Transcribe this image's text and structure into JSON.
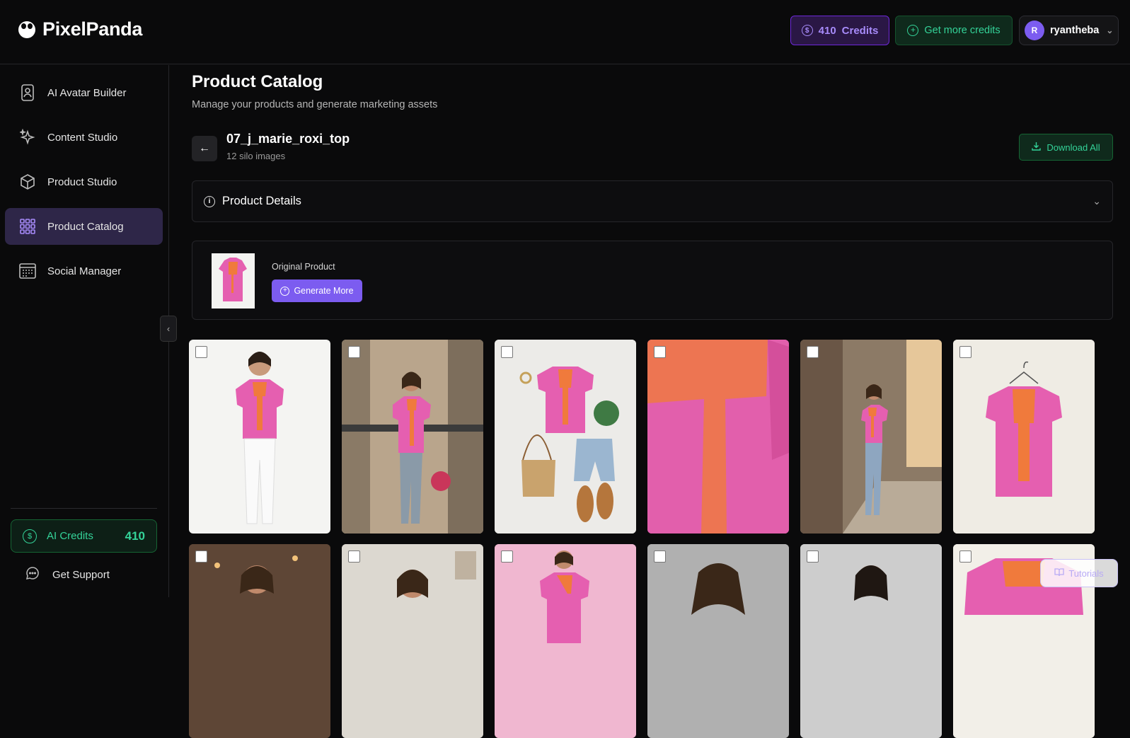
{
  "app": {
    "name": "PixelPanda"
  },
  "header": {
    "credits_count": "410",
    "credits_label": "Credits",
    "get_more_label": "Get more credits",
    "user_initial": "R",
    "username": "ryantheba"
  },
  "sidebar": {
    "items": [
      {
        "label": "AI Avatar Builder",
        "icon": "avatar-icon"
      },
      {
        "label": "Content Studio",
        "icon": "sparkle-icon"
      },
      {
        "label": "Product Studio",
        "icon": "box-icon"
      },
      {
        "label": "Product Catalog",
        "icon": "grid-icon",
        "active": true
      },
      {
        "label": "Social Manager",
        "icon": "calendar-icon"
      }
    ],
    "ai_credits_label": "AI Credits",
    "ai_credits_value": "410",
    "support_label": "Get Support"
  },
  "main": {
    "title": "Product Catalog",
    "subtitle": "Manage your products and generate marketing assets",
    "product_name": "07_j_marie_roxi_top",
    "image_count": "12 silo images",
    "download_all_label": "Download All",
    "details_label": "Product Details",
    "original_label": "Original Product",
    "generate_more_label": "Generate More"
  },
  "grid": {
    "images": [
      "model-white-jeans",
      "model-balcony",
      "flatlay-outfit",
      "fabric-closeup",
      "model-street",
      "top-on-hanger",
      "model-cafe",
      "model-living-room",
      "model-pink-backdrop",
      "model-studio",
      "model-grey-backdrop",
      "top-detail"
    ]
  },
  "tutorials_label": "Tutorials",
  "colors": {
    "accent": "#7c5cf0",
    "success": "#34d399",
    "blouse": "#e55fb0",
    "embroidery": "#f07a3c"
  }
}
